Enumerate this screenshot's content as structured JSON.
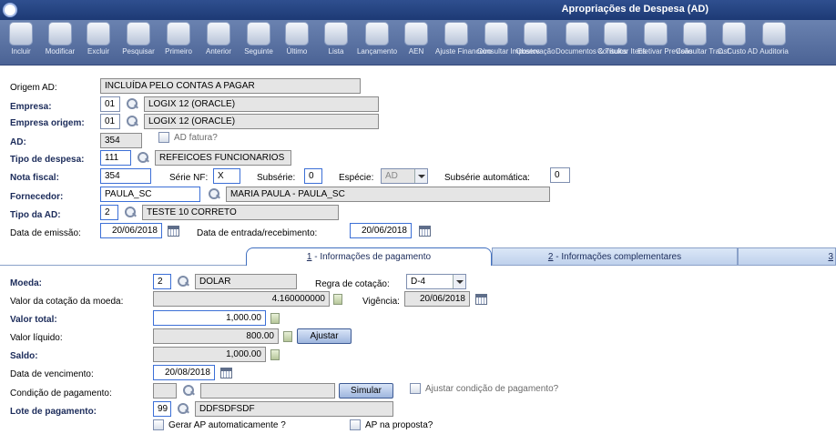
{
  "window": {
    "title": "Apropriações de Despesa (AD)"
  },
  "toolbar": [
    {
      "label": "Incluir",
      "icon": "add-icon"
    },
    {
      "label": "Modificar",
      "icon": "edit-icon"
    },
    {
      "label": "Excluir",
      "icon": "trash-icon"
    },
    {
      "label": "Pesquisar",
      "icon": "search-icon"
    },
    {
      "label": "Primeiro",
      "icon": "first-icon"
    },
    {
      "label": "Anterior",
      "icon": "previous-icon"
    },
    {
      "label": "Seguinte",
      "icon": "next-icon"
    },
    {
      "label": "Último",
      "icon": "last-icon"
    },
    {
      "label": "Lista",
      "icon": "list-icon"
    },
    {
      "label": "Lançamento",
      "icon": "entry-icon"
    },
    {
      "label": "AEN",
      "icon": "aen-icon"
    },
    {
      "label": "Ajuste Financeiro",
      "icon": "finance-adjust-icon"
    },
    {
      "label": "Consultar Impostos",
      "icon": "taxes-icon"
    },
    {
      "label": "Observação",
      "icon": "note-icon"
    },
    {
      "label": "Documentos & Títulos",
      "icon": "documents-icon"
    },
    {
      "label": "Consultar Itens",
      "icon": "items-icon"
    },
    {
      "label": "Efetivar Previsão",
      "icon": "forecast-icon"
    },
    {
      "label": "Consultar Transf.",
      "icon": "transfer-icon"
    },
    {
      "label": "C. Custo AD",
      "icon": "cost-center-icon"
    },
    {
      "label": "Auditoria",
      "icon": "audit-icon"
    }
  ],
  "form": {
    "origem_ad": {
      "label": "Origem AD:",
      "value": "INCLUÍDA PELO CONTAS A PAGAR"
    },
    "empresa": {
      "label": "Empresa:",
      "code": "01",
      "name": "LOGIX 12 (ORACLE)"
    },
    "empresa_origem": {
      "label": "Empresa origem:",
      "code": "01",
      "name": "LOGIX 12 (ORACLE)"
    },
    "ad": {
      "label": "AD:",
      "value": "354",
      "fatura_label": "AD fatura?"
    },
    "tipo_despesa": {
      "label": "Tipo de despesa:",
      "code": "111",
      "name": "REFEICOES  FUNCIONARIOS"
    },
    "nota_fiscal": {
      "label": "Nota fiscal:",
      "value": "354",
      "serie_label": "Série NF:",
      "serie": "X",
      "subserie_label": "Subsérie:",
      "subserie": "0",
      "especie_label": "Espécie:",
      "especie": "AD",
      "subserie_auto_label": "Subsérie automática:",
      "subserie_auto": "0"
    },
    "fornecedor": {
      "label": "Fornecedor:",
      "code": "PAULA_SC",
      "name": "MARIA PAULA - PAULA_SC"
    },
    "tipo_ad": {
      "label": "Tipo da AD:",
      "code": "2",
      "name": "TESTE 10 CORRETO"
    },
    "data_emissao": {
      "label": "Data de emissão:",
      "value": "20/06/2018"
    },
    "data_entrada": {
      "label": "Data de entrada/recebimento:",
      "value": "20/06/2018"
    }
  },
  "tabs": [
    {
      "num": "1",
      "label": " - Informações de pagamento"
    },
    {
      "num": "2",
      "label": " - Informações complementares"
    },
    {
      "num": "3",
      "label": ""
    }
  ],
  "pagamento": {
    "moeda": {
      "label": "Moeda:",
      "code": "2",
      "name": "DOLAR"
    },
    "regra": {
      "label": "Regra de cotação:",
      "value": "D-4"
    },
    "cotacao": {
      "label": "Valor da cotação da moeda:",
      "value": "4.160000000",
      "vigencia_label": "Vigência:",
      "vigencia": "20/06/2018"
    },
    "valor_total": {
      "label": "Valor total:",
      "value": "1,000.00"
    },
    "valor_liquido": {
      "label": "Valor líquido:",
      "value": "800.00",
      "button": "Ajustar"
    },
    "saldo": {
      "label": "Saldo:",
      "value": "1,000.00"
    },
    "vencimento": {
      "label": "Data de vencimento:",
      "value": "20/08/2018"
    },
    "condicao": {
      "label": "Condição de pagamento:",
      "button": "Simular",
      "ajustar_label": "Ajustar condição de pagamento?"
    },
    "lote": {
      "label": "Lote de pagamento:",
      "code": "99",
      "name": "DDFSDFSDF"
    },
    "gerar_ap_label": "Gerar AP automaticamente ?",
    "ap_proposta_label": "AP na proposta?"
  }
}
